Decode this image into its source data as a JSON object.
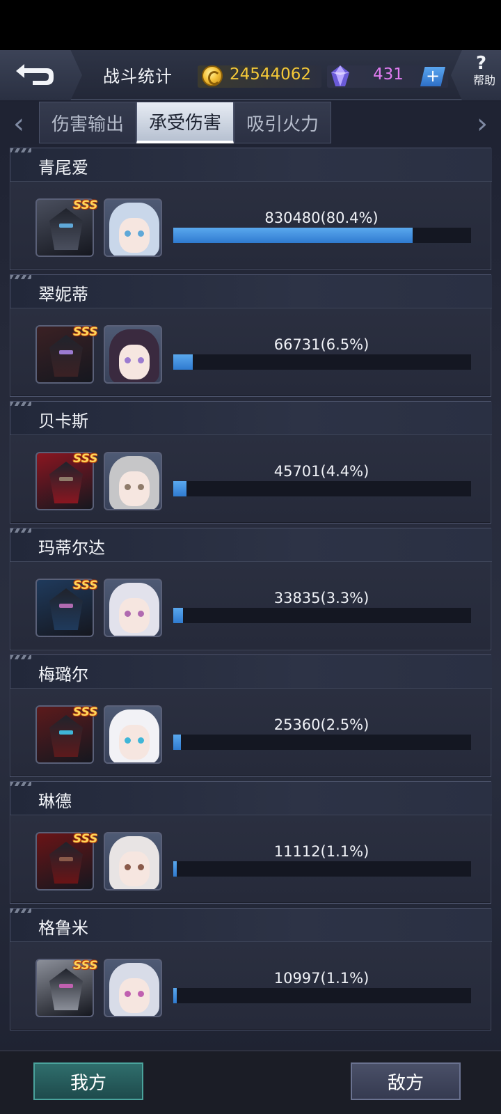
{
  "header": {
    "title": "战斗统计",
    "gold": "24544062",
    "gems": "431",
    "plus": "+",
    "help_symbol": "?",
    "help_label": "帮助"
  },
  "tabs": [
    {
      "label": "伤害输出",
      "active": false
    },
    {
      "label": "承受伤害",
      "active": true
    },
    {
      "label": "吸引火力",
      "active": false
    }
  ],
  "nav": {
    "left_arrow": "‹",
    "right_arrow": "›"
  },
  "rows": [
    {
      "name": "青尾爱",
      "grade": "SSS",
      "value_text": "830480(80.4%)",
      "percent": 80.4,
      "mech_color": "#4a4f5e",
      "pilot_hair": "#c9d7ea",
      "pilot_eye": "#5fa8d8"
    },
    {
      "name": "翠妮蒂",
      "grade": "SSS",
      "value_text": "66731(6.5%)",
      "percent": 6.5,
      "mech_color": "#3b2124",
      "pilot_hair": "#3a2a3f",
      "pilot_eye": "#9b7bd0"
    },
    {
      "name": "贝卡斯",
      "grade": "SSS",
      "value_text": "45701(4.4%)",
      "percent": 4.4,
      "mech_color": "#8a1620",
      "pilot_hair": "#c6c6c8",
      "pilot_eye": "#8f7b6a"
    },
    {
      "name": "玛蒂尔达",
      "grade": "SSS",
      "value_text": "33835(3.3%)",
      "percent": 3.3,
      "mech_color": "#1f3a5c",
      "pilot_hair": "#e2e2ec",
      "pilot_eye": "#b06ab0"
    },
    {
      "name": "梅璐尔",
      "grade": "SSS",
      "value_text": "25360(2.5%)",
      "percent": 2.5,
      "mech_color": "#5c1a1c",
      "pilot_hair": "#f2f2f6",
      "pilot_eye": "#3fb6d8"
    },
    {
      "name": "琳德",
      "grade": "SSS",
      "value_text": "11112(1.1%)",
      "percent": 1.1,
      "mech_color": "#6a1416",
      "pilot_hair": "#e8e4e4",
      "pilot_eye": "#8a5a4a"
    },
    {
      "name": "格鲁米",
      "grade": "SSS",
      "value_text": "10997(1.1%)",
      "percent": 1.1,
      "mech_color": "#8b8f99",
      "pilot_hair": "#d8dce8",
      "pilot_eye": "#c060b0"
    }
  ],
  "bottom": {
    "ours": "我方",
    "enemy": "敌方"
  }
}
